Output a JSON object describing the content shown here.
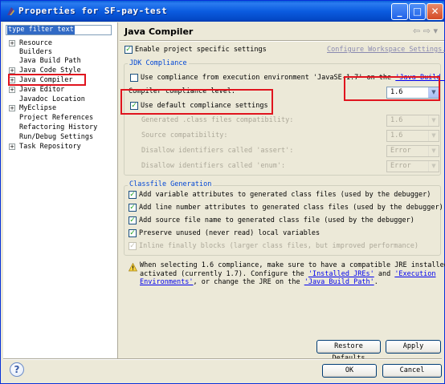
{
  "window": {
    "title": "Properties for SF-pay-test",
    "minimize": "_",
    "maximize": "□",
    "close": "✕"
  },
  "sidebar": {
    "filter_value": "type filter text",
    "items": [
      {
        "label": "Resource",
        "toggle": "+"
      },
      {
        "label": "Builders",
        "toggle": ""
      },
      {
        "label": "Java Build Path",
        "toggle": ""
      },
      {
        "label": "Java Code Style",
        "toggle": "+"
      },
      {
        "label": "Java Compiler",
        "toggle": "+"
      },
      {
        "label": "Java Editor",
        "toggle": "+"
      },
      {
        "label": "Javadoc Location",
        "toggle": ""
      },
      {
        "label": "MyEclipse",
        "toggle": "+"
      },
      {
        "label": "Project References",
        "toggle": ""
      },
      {
        "label": "Refactoring History",
        "toggle": ""
      },
      {
        "label": "Run/Debug Settings",
        "toggle": ""
      },
      {
        "label": "Task Repository",
        "toggle": "+"
      }
    ]
  },
  "page": {
    "title": "Java Compiler",
    "nav_back": "⇦",
    "nav_forward": "⇨",
    "nav_menu": "▾",
    "enable_specific": {
      "label": "Enable project specific settings",
      "checked": true
    },
    "configure_link": "Configure Workspace Settings...",
    "jdk": {
      "group_title": "JDK Compliance",
      "use_env": {
        "prefix": "Use compliance from execution environment 'JavaSE-1.7' on the ",
        "link": "'Java Build Path'",
        "checked": false
      },
      "level_label": "Compiler compliance level:",
      "level_value": "1.6",
      "use_default": {
        "label": "Use default compliance settings",
        "checked": true
      },
      "rows": [
        {
          "label": "Generated .class files compatibility:",
          "value": "1.6"
        },
        {
          "label": "Source compatibility:",
          "value": "1.6"
        },
        {
          "label": "Disallow identifiers called 'assert':",
          "value": "Error"
        },
        {
          "label": "Disallow identifiers called 'enum':",
          "value": "Error"
        }
      ]
    },
    "classfile": {
      "group_title": "Classfile Generation",
      "options": [
        {
          "label": "Add variable attributes to generated class files (used by the debugger)",
          "checked": true,
          "disabled": false
        },
        {
          "label": "Add line number attributes to generated class files (used by the debugger)",
          "checked": true,
          "disabled": false
        },
        {
          "label": "Add source file name to generated class file (used by the debugger)",
          "checked": true,
          "disabled": false
        },
        {
          "label": "Preserve unused (never read) local variables",
          "checked": true,
          "disabled": false
        },
        {
          "label": "Inline finally blocks (larger class files, but improved performance)",
          "checked": true,
          "disabled": true
        }
      ]
    },
    "warning": {
      "line1": "When selecting 1.6 compliance, make sure to have a compatible JRE installed and",
      "line2_prefix": "activated (currently 1.7). Configure the ",
      "link1": "'Installed JREs'",
      "mid": " and ",
      "link2a": "'Execution",
      "link2b": "Environments'",
      "line3_mid": ", or change the JRE on the ",
      "link3": "'Java Build Path'",
      "line3_end": "."
    },
    "restore_defaults": "Restore Defaults",
    "apply": "Apply"
  },
  "footer": {
    "ok": "OK",
    "cancel": "Cancel",
    "help": "?"
  }
}
